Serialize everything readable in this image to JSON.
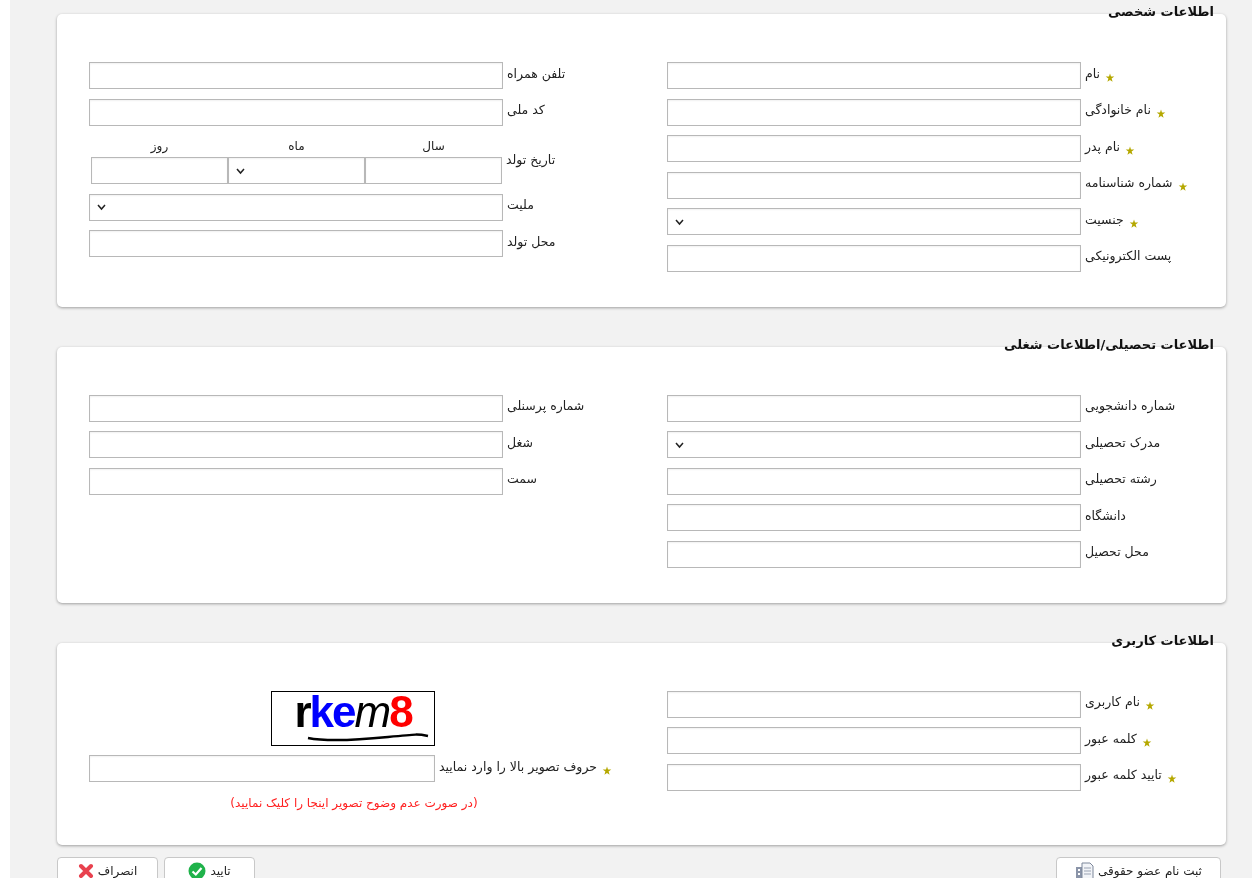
{
  "sections": [
    {
      "title": "اطلاعات شخصی",
      "columns": [
        [
          {
            "kind": "text",
            "label": "نام",
            "required": true
          },
          {
            "kind": "text",
            "label": "نام خانوادگی",
            "required": true
          },
          {
            "kind": "text",
            "label": "نام پدر",
            "required": true
          },
          {
            "kind": "text",
            "label": "شماره شناسنامه",
            "required": true
          },
          {
            "kind": "select",
            "label": "جنسیت",
            "required": true
          },
          {
            "kind": "text",
            "label": "پست الکترونیکی",
            "required": false
          }
        ],
        [
          {
            "kind": "text",
            "label": "تلفن همراه",
            "required": false
          },
          {
            "kind": "text",
            "label": "کد ملی",
            "required": false
          },
          {
            "kind": "date",
            "label": "تاریخ تولد",
            "required": false,
            "parts": [
              {
                "kind": "text",
                "label": "سال"
              },
              {
                "kind": "select",
                "label": "ماه"
              },
              {
                "kind": "text",
                "label": "روز"
              }
            ]
          },
          {
            "kind": "select",
            "label": "ملیت",
            "required": false
          },
          {
            "kind": "text",
            "label": "محل تولد",
            "required": false
          }
        ]
      ]
    },
    {
      "title": "اطلاعات تحصیلی/اطلاعات شغلی",
      "columns": [
        [
          {
            "kind": "text",
            "label": "شماره دانشجویی",
            "required": false
          },
          {
            "kind": "select",
            "label": "مدرک تحصیلی",
            "required": false
          },
          {
            "kind": "text",
            "label": "رشته تحصیلی",
            "required": false
          },
          {
            "kind": "text",
            "label": "دانشگاه",
            "required": false
          },
          {
            "kind": "text",
            "label": "محل تحصیل",
            "required": false
          }
        ],
        [
          {
            "kind": "text",
            "label": "شماره پرسنلی",
            "required": false
          },
          {
            "kind": "text",
            "label": "شغل",
            "required": false
          },
          {
            "kind": "text",
            "label": "سمت",
            "required": false
          }
        ]
      ]
    },
    {
      "title": "اطلاعات کاربری",
      "columns": [
        [
          {
            "kind": "text",
            "label": "نام کاربری",
            "required": true
          },
          {
            "kind": "text",
            "label": "کلمه عبور",
            "required": true
          },
          {
            "kind": "text",
            "label": "تایید کلمه عبور",
            "required": true
          }
        ],
        [
          {
            "kind": "captcha_image",
            "text": "rkem8",
            "letter_styles": [
              {
                "color": "#000000",
                "italic": false
              },
              {
                "color": "#0000ff",
                "italic": false
              },
              {
                "color": "#0000ff",
                "italic": false
              },
              {
                "color": "#000000",
                "italic": true
              },
              {
                "color": "#ff0000",
                "italic": false
              }
            ]
          },
          {
            "kind": "captcha_field",
            "label": "حروف تصویر بالا را وارد نمایید",
            "required": true
          },
          {
            "kind": "captcha_link",
            "label": "(در صورت عدم وضوح تصویر اینجا را کلیک نمایید)"
          }
        ]
      ]
    }
  ],
  "buttons": [
    {
      "kind": "legal",
      "label": "ثبت نام عضو حقوقی"
    },
    {
      "kind": "confirm",
      "label": "تایید"
    },
    {
      "kind": "cancel",
      "label": "انصراف"
    }
  ]
}
